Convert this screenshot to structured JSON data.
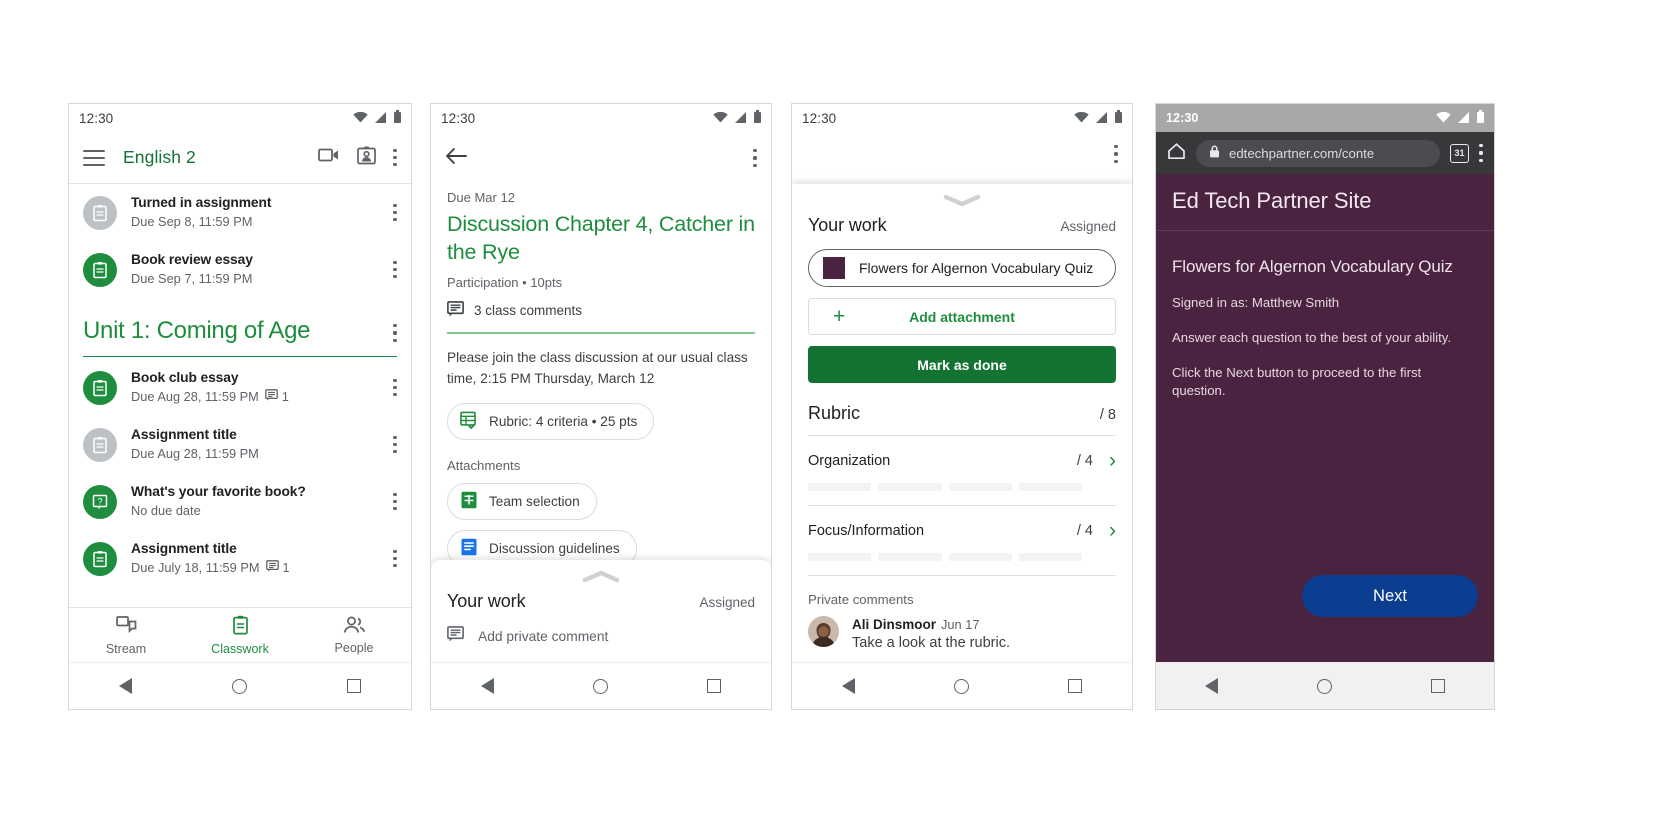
{
  "status_bar": {
    "time": "12:30",
    "icons": [
      "wifi-icon",
      "signal-icon",
      "battery-icon"
    ]
  },
  "panel1": {
    "app_bar": {
      "menu_icon": "hamburger-icon",
      "class_title": "English 2",
      "actions": [
        "video-camera-icon",
        "class-card-icon",
        "overflow-menu-icon"
      ]
    },
    "upcoming": [
      {
        "title": "Turned in assignment",
        "subtitle": "Due Sep 8, 11:59 PM",
        "icon": "assignment-icon",
        "state": "grey"
      },
      {
        "title": "Book review essay",
        "subtitle": "Due Sep 7, 11:59 PM",
        "icon": "assignment-icon",
        "state": "green"
      }
    ],
    "topic": {
      "title": "Unit 1: Coming of Age"
    },
    "items": [
      {
        "title": "Book club essay",
        "subtitle": "Due Aug 28, 11:59 PM",
        "comments": "1",
        "icon": "assignment-icon",
        "state": "green"
      },
      {
        "title": "Assignment title",
        "subtitle": "Due Aug 28, 11:59 PM",
        "comments": "",
        "icon": "assignment-icon",
        "state": "grey"
      },
      {
        "title": "What's your favorite book?",
        "subtitle": "No due date",
        "comments": "",
        "icon": "question-icon",
        "state": "green"
      },
      {
        "title": "Assignment title",
        "subtitle": "Due July 18, 11:59 PM",
        "comments": "1",
        "icon": "assignment-icon",
        "state": "green"
      }
    ],
    "bottom_nav": [
      {
        "label": "Stream",
        "icon": "stream-icon",
        "active": false
      },
      {
        "label": "Classwork",
        "icon": "classwork-icon",
        "active": true
      },
      {
        "label": "People",
        "icon": "people-icon",
        "active": false
      }
    ]
  },
  "panel2": {
    "back_icon": "back-arrow-icon",
    "overflow_icon": "overflow-menu-icon",
    "due_label": "Due Mar 12",
    "title": "Discussion Chapter 4, Catcher in the Rye",
    "meta": "Participation • 10pts",
    "class_comments": "3 class comments",
    "description": "Please join the class discussion at our usual class time, 2:15 PM Thursday, March 12",
    "rubric_chip": "Rubric: 4 criteria • 25 pts",
    "attachments_header": "Attachments",
    "attachments": [
      {
        "name": "Team selection",
        "icon": "google-sheets-icon"
      },
      {
        "name": "Discussion guidelines",
        "icon": "google-docs-icon"
      }
    ],
    "sheet": {
      "your_work": "Your work",
      "status": "Assigned",
      "private_comment_placeholder": "Add private comment",
      "comment_icon": "comment-icon",
      "grabber_icon": "chevron-up-icon"
    }
  },
  "panel3": {
    "overflow_icon": "overflow-menu-icon",
    "grabber_icon": "chevron-down-icon",
    "your_work": "Your work",
    "status": "Assigned",
    "attachment": {
      "name": "Flowers for Algernon Vocabulary Quiz",
      "swatch_color": "#4a2340"
    },
    "add_attachment": "Add attachment",
    "add_icon": "plus-icon",
    "mark_as_done": "Mark as done",
    "rubric": {
      "title": "Rubric",
      "total": "/ 8",
      "criteria": [
        {
          "name": "Organization",
          "points": "/ 4",
          "chevron": "chevron-right-icon",
          "levels": 4
        },
        {
          "name": "Focus/Information",
          "points": "/ 4",
          "chevron": "chevron-right-icon",
          "levels": 4
        }
      ]
    },
    "private_comments": {
      "header": "Private comments",
      "items": [
        {
          "author": "Ali Dinsmoor",
          "date": "Jun 17",
          "text": "Take a look at the rubric.",
          "avatar": "user-avatar"
        }
      ]
    }
  },
  "panel4": {
    "browser": {
      "home_icon": "home-icon",
      "lock_icon": "lock-icon",
      "url": "edtechpartner.com/conte",
      "tab_count": "31",
      "tabs_icon": "tab-switcher-icon",
      "overflow_icon": "overflow-menu-icon"
    },
    "site": {
      "header_title": "Ed Tech Partner Site",
      "quiz_title": "Flowers for Algernon Vocabulary Quiz",
      "lines": [
        "Signed in as: Matthew Smith",
        "Answer each question to the best of your ability.",
        "Click the Next button to proceed to the first question."
      ],
      "next_button": "Next",
      "background_color": "#4a2340",
      "next_button_color": "#0b3d91"
    }
  },
  "system_nav": {
    "back": "back-triangle-icon",
    "home": "home-circle-icon",
    "recents": "recents-square-icon"
  }
}
